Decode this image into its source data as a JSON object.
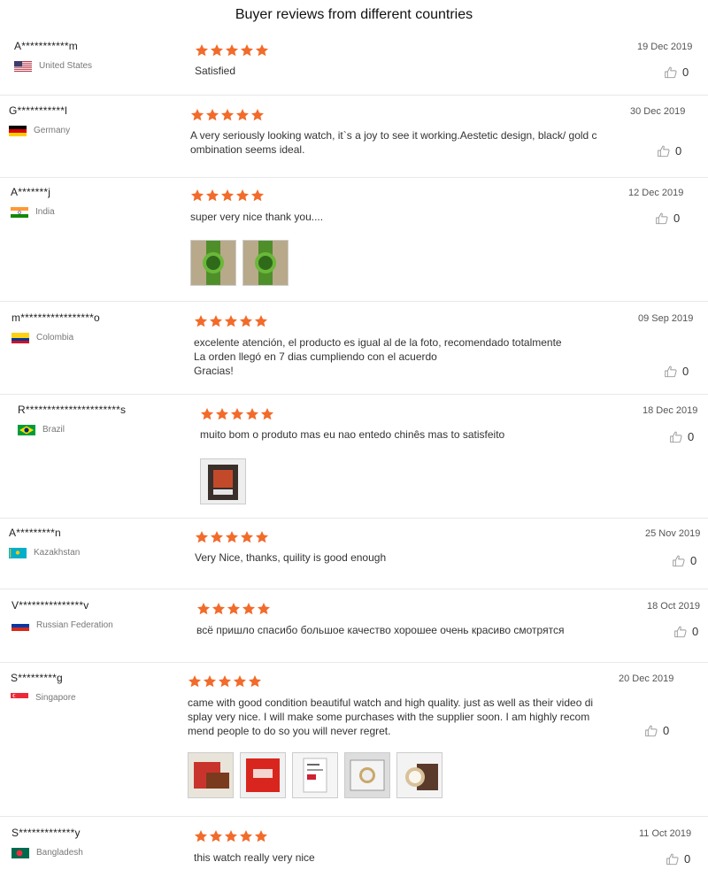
{
  "page": {
    "title": "Buyer reviews from different countries"
  },
  "colors": {
    "star": "#f26b2a",
    "thumb_icon": "#999999"
  },
  "reviews": [
    {
      "name": "A***********m",
      "country": "United States",
      "flag": "us",
      "rating": 5,
      "text_lines": [
        "Satisfied"
      ],
      "date": "19 Dec 2019",
      "likes": "0",
      "photos": []
    },
    {
      "name": "G***********l",
      "country": "Germany",
      "flag": "de",
      "rating": 5,
      "text_lines": [
        "A very seriously looking watch, it`s a joy to see it working.Aestetic design, black/ gold c",
        "ombination seems ideal."
      ],
      "date": "30 Dec 2019",
      "likes": "0",
      "photos": []
    },
    {
      "name": "A*******j",
      "country": "India",
      "flag": "in",
      "rating": 5,
      "text_lines": [
        "super very nice thank you...."
      ],
      "date": "12 Dec 2019",
      "likes": "0",
      "photos": [
        "green-watch-photo",
        "green-watch-photo"
      ]
    },
    {
      "name": "m*****************o",
      "country": "Colombia",
      "flag": "co",
      "rating": 5,
      "text_lines": [
        "excelente atención, el producto es igual al de la foto, recomendado totalmente",
        "La orden llegó en 7 dias cumpliendo con el acuerdo",
        "Gracias!"
      ],
      "date": "09 Sep 2019",
      "likes": "0",
      "photos": []
    },
    {
      "name": "R**********************s",
      "country": "Brazil",
      "flag": "br",
      "rating": 5,
      "text_lines": [
        "muito bom o produto mas eu nao entedo chinês mas to satisfeito"
      ],
      "date": "18 Dec 2019",
      "likes": "0",
      "photos": [
        "watch-package-photo"
      ]
    },
    {
      "name": "A*********n",
      "country": "Kazakhstan",
      "flag": "kz",
      "rating": 5,
      "text_lines": [
        "Very Nice, thanks, quility is good enough"
      ],
      "date": "25 Nov 2019",
      "likes": "0",
      "photos": []
    },
    {
      "name": "V***************v",
      "country": "Russian Federation",
      "flag": "ru",
      "rating": 5,
      "text_lines": [
        "всё пришло спасибо большое качество хорошее очень красиво смотрятся"
      ],
      "date": "18 Oct 2019",
      "likes": "0",
      "photos": []
    },
    {
      "name": "S*********g",
      "country": "Singapore",
      "flag": "sg",
      "rating": 5,
      "text_lines": [
        "came with good condition beautiful watch and high quality. just as well as their video di",
        "splay  very nice. I will make some purchases with the supplier soon. I am highly recom",
        "mend people to do so you will never regret."
      ],
      "date": "20 Dec 2019",
      "likes": "0",
      "photos": [
        "box-photo",
        "red-bag-photo",
        "receipt-photo",
        "watch-in-box-photo",
        "watch-box-photo"
      ]
    },
    {
      "name": "S*************y",
      "country": "Bangladesh",
      "flag": "bd",
      "rating": 5,
      "text_lines": [
        "this watch really very nice"
      ],
      "date": "11 Oct 2019",
      "likes": "0",
      "photos": []
    }
  ]
}
